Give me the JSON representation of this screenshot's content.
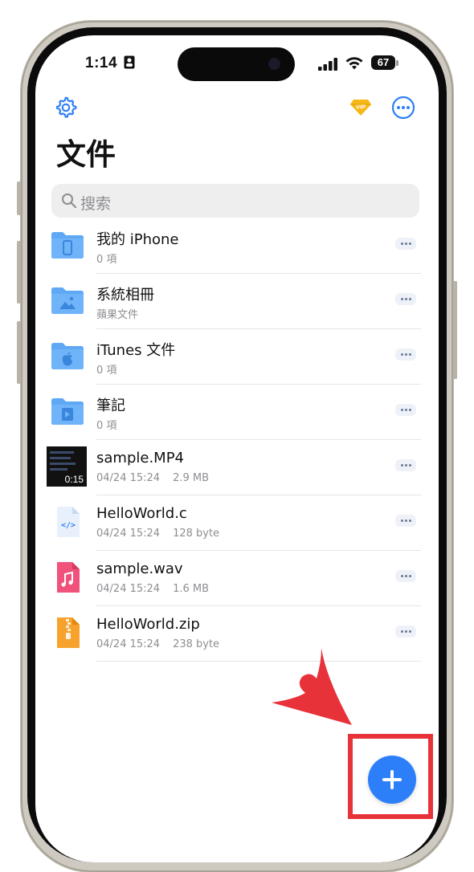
{
  "status_bar": {
    "time": "1:14",
    "battery": "67"
  },
  "header": {
    "title": "文件",
    "settings_icon": "gear-icon",
    "vip_badge": "VIP",
    "more_icon": "ellipsis-circle-icon"
  },
  "search": {
    "placeholder": "搜索"
  },
  "files": [
    {
      "name": "我的 iPhone",
      "meta": [
        "0 項"
      ],
      "icon": "folder-phone-icon"
    },
    {
      "name": "系統相冊",
      "meta": [
        "蘋果文件"
      ],
      "icon": "folder-photo-icon"
    },
    {
      "name": "iTunes 文件",
      "meta": [
        "0 項"
      ],
      "icon": "folder-apple-icon"
    },
    {
      "name": "筆記",
      "meta": [
        "0 項"
      ],
      "icon": "folder-notes-icon"
    },
    {
      "name": "sample.MP4",
      "meta": [
        "04/24 15:24",
        "2.9 MB"
      ],
      "icon": "video-thumbnail",
      "duration": "0:15"
    },
    {
      "name": "HelloWorld.c",
      "meta": [
        "04/24 15:24",
        "128 byte"
      ],
      "icon": "code-file-icon"
    },
    {
      "name": "sample.wav",
      "meta": [
        "04/24 15:24",
        "1.6 MB"
      ],
      "icon": "audio-file-icon"
    },
    {
      "name": "HelloWorld.zip",
      "meta": [
        "04/24 15:24",
        "238 byte"
      ],
      "icon": "zip-file-icon"
    }
  ],
  "colors": {
    "accent": "#2d7ff9",
    "folder": "#5ea8f5",
    "annotation": "#e8323a"
  },
  "fab_icon": "plus-icon"
}
